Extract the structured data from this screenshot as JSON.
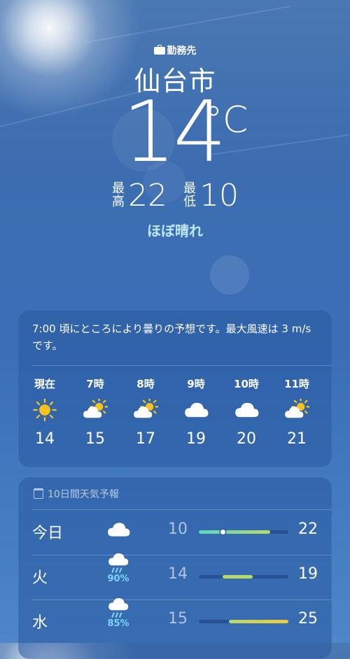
{
  "location": {
    "tag_icon": "briefcase-icon",
    "tag": "勤務先",
    "city": "仙台市",
    "temperature": "14",
    "unit": "°C",
    "high_label": "最高",
    "high": "22",
    "low_label": "最低",
    "low": "10",
    "condition": "ほぼ晴れ"
  },
  "hourly": {
    "summary": "7:00 頃にところにより曇りの予想です。最大風速は 3 m/s です。",
    "items": [
      {
        "time": "現在",
        "icon": "sun-icon",
        "temp": "14"
      },
      {
        "time": "7時",
        "icon": "partly-cloudy-icon",
        "temp": "15"
      },
      {
        "time": "8時",
        "icon": "partly-cloudy-icon",
        "temp": "17"
      },
      {
        "time": "9時",
        "icon": "cloud-icon",
        "temp": "19"
      },
      {
        "time": "10時",
        "icon": "cloud-icon",
        "temp": "20"
      },
      {
        "time": "11時",
        "icon": "partly-cloudy-icon",
        "temp": "21"
      }
    ]
  },
  "forecast": {
    "header_icon": "calendar-icon",
    "header": "10日間天気予報",
    "days": [
      {
        "day": "今日",
        "icon": "cloud-icon",
        "precip": "",
        "low": "10",
        "high": "22",
        "current": 14
      },
      {
        "day": "火",
        "icon": "rain-icon",
        "precip": "90%",
        "low": "14",
        "high": "19"
      },
      {
        "day": "水",
        "icon": "rain-icon",
        "precip": "85%",
        "low": "15",
        "high": "25"
      }
    ],
    "range_min": 10,
    "range_max": 25
  },
  "colors": {
    "sun": "#f7c21b",
    "cloud": "#ffffff",
    "rain": "#7fd4ff",
    "bar_cool": "#5fd6c0",
    "bar_mid": "#b8d96a",
    "bar_warm": "#f2c93a"
  }
}
